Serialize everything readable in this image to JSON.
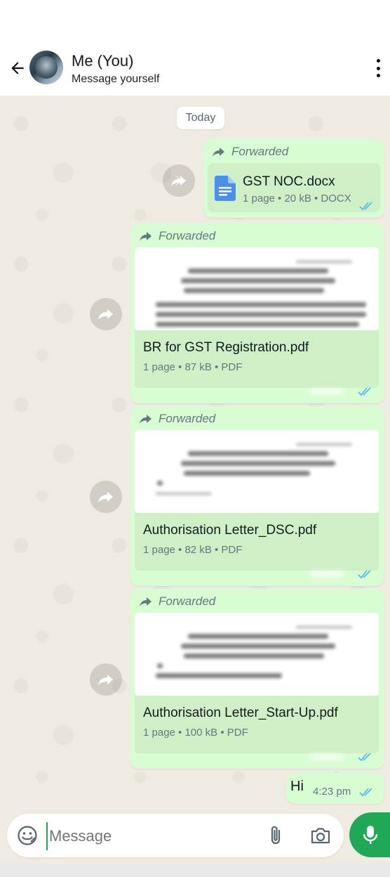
{
  "header": {
    "title": "Me (You)",
    "subtitle": "Message yourself"
  },
  "chat": {
    "date_chip": "Today",
    "messages": [
      {
        "forwarded_label": "Forwarded",
        "file_name": "GST NOC.docx",
        "file_meta": "1 page • 20 kB • DOCX"
      },
      {
        "forwarded_label": "Forwarded",
        "file_name": "BR for GST Registration.pdf",
        "file_meta": "1 page • 87 kB • PDF"
      },
      {
        "forwarded_label": "Forwarded",
        "file_name": "Authorisation Letter_DSC.pdf",
        "file_meta": "1 page • 82 kB • PDF"
      },
      {
        "forwarded_label": "Forwarded",
        "file_name": "Authorisation Letter_Start-Up.pdf",
        "file_meta": "1 page • 100 kB • PDF"
      },
      {
        "text": "Hi",
        "time": "4:23 pm"
      }
    ]
  },
  "composer": {
    "placeholder": "Message"
  },
  "colors": {
    "accent": "#1fa855",
    "outgoing_bubble": "#d9fdd3",
    "read_ticks": "#53bdeb"
  },
  "icons": [
    "back-arrow-icon",
    "more-vert-icon",
    "forward-icon",
    "document-icon",
    "double-check-icon",
    "emoji-icon",
    "attach-icon",
    "camera-icon",
    "mic-icon"
  ]
}
